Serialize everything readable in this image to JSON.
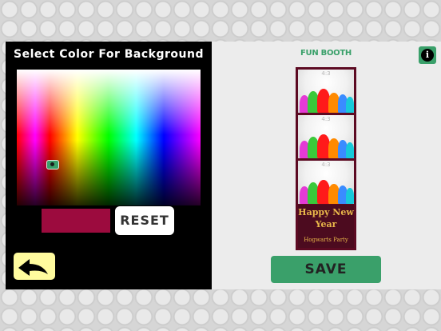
{
  "left_panel": {
    "title": "Select Color For Background",
    "selected_color": "#9c0b3e",
    "reset_label": "RESET"
  },
  "right_panel": {
    "logo_text": "FUN BOOTH",
    "info_label": "i",
    "photos": [
      {
        "label": "4:3"
      },
      {
        "label": "4:3"
      },
      {
        "label": "4:3"
      }
    ],
    "greeting_title": "Happy New Year",
    "greeting_subtitle": "Hogwarts Party",
    "save_label": "SAVE"
  },
  "colors": {
    "accent": "#3aa06a",
    "strip_border": "#5c0a22",
    "greeting_bg": "#4c0b1f",
    "greeting_text": "#e8b74a",
    "back_button": "#fffb9e"
  }
}
